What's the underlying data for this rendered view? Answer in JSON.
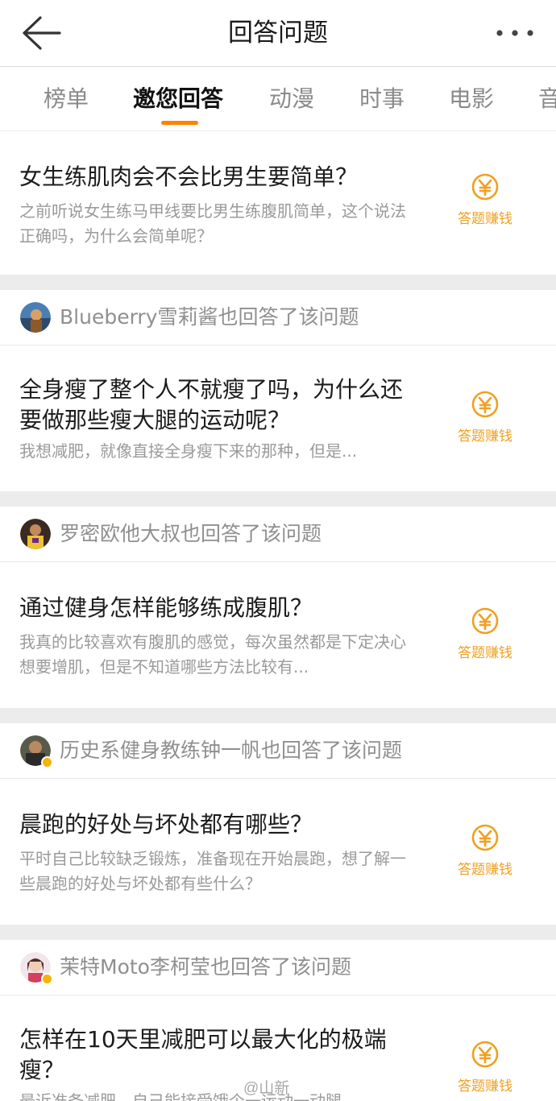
{
  "header": {
    "title": "回答问题"
  },
  "tabs": [
    "榜单",
    "邀您回答",
    "动漫",
    "时事",
    "电影",
    "音"
  ],
  "active_tab_index": 1,
  "accent_color": "#ff8200",
  "earn_color": "#f0a020",
  "earn_label": "答题赚钱",
  "questions": [
    {
      "title": "女生练肌肉会不会比男生要简单？",
      "desc": "之前听说女生练马甲线要比男生练腹肌简单，这个说法正确吗，为什么会简单呢？"
    },
    {
      "answered_by": "Blueberry雪莉酱也回答了该问题",
      "title": "全身瘦了整个人不就瘦了吗，为什么还要做那些瘦大腿的运动呢？",
      "desc": "我想减肥，就像直接全身瘦下来的那种，但是..."
    },
    {
      "answered_by": "罗密欧他大叔也回答了该问题",
      "title": "通过健身怎样能够练成腹肌？",
      "desc": "我真的比较喜欢有腹肌的感觉，每次虽然都是下定决心想要增肌，但是不知道哪些方法比较有..."
    },
    {
      "answered_by": "历史系健身教练钟一帆也回答了该问题",
      "title": "晨跑的好处与坏处都有哪些？",
      "desc": "平时自己比较缺乏锻炼，准备现在开始晨跑，想了解一些晨跑的好处与坏处都有些什么？"
    },
    {
      "answered_by": "茉特Moto李柯莹也回答了该问题",
      "title": "怎样在10天里减肥可以最大化的极端瘦？",
      "desc": "最近准备减肥，自己能接受饿个一运动一动腿"
    }
  ],
  "watermark": "@山新"
}
